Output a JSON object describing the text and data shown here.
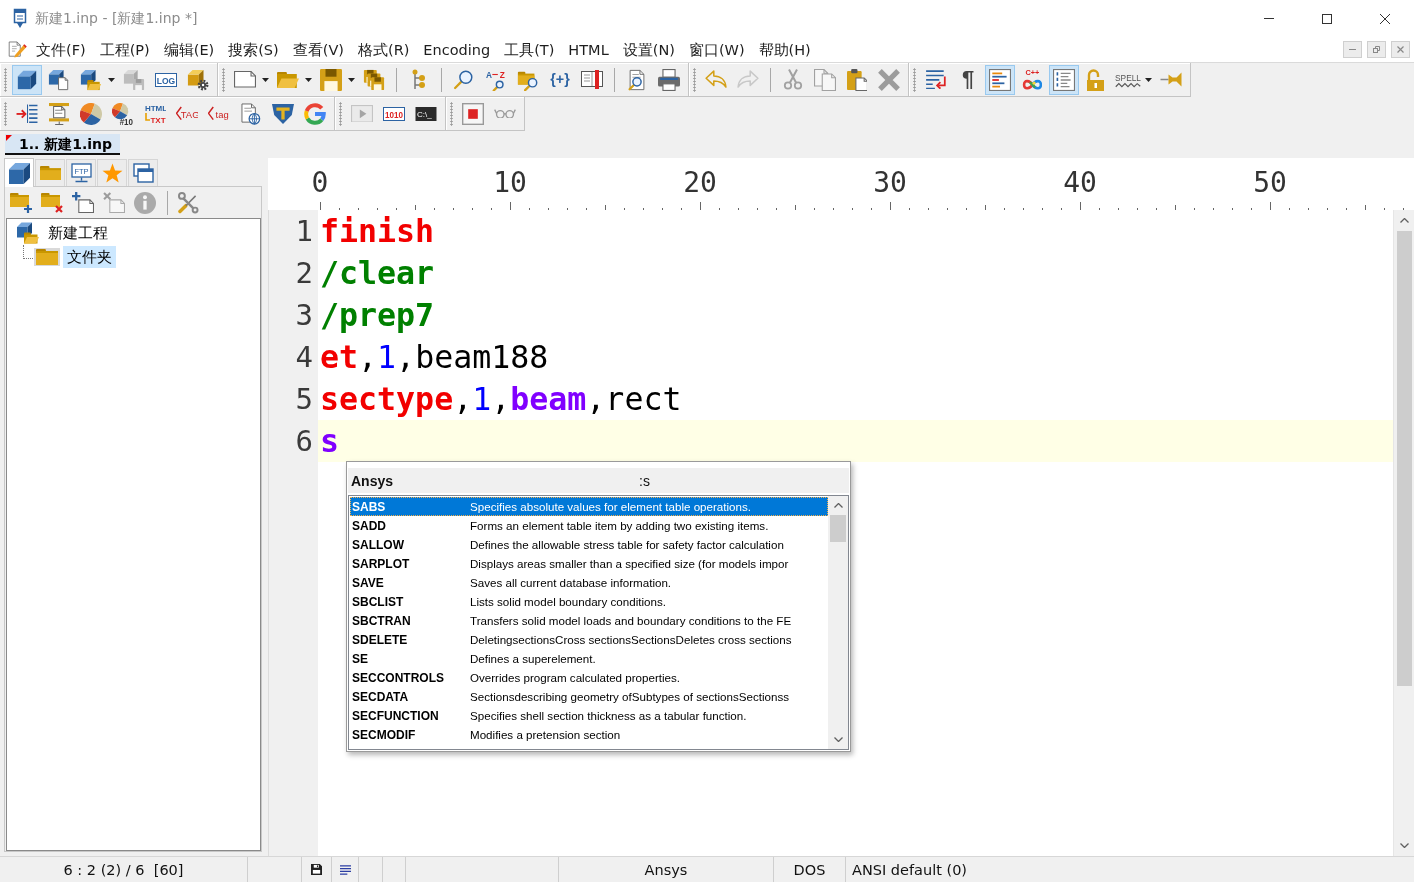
{
  "window": {
    "title": "新建1.inp - [新建1.inp *]"
  },
  "menu": [
    "文件(F)",
    "工程(P)",
    "编辑(E)",
    "搜索(S)",
    "查看(V)",
    "格式(R)",
    "Encoding",
    "工具(T)",
    "HTML",
    "设置(N)",
    "窗口(W)",
    "帮助(H)"
  ],
  "toolbar_rows": [
    {
      "bands": [
        {
          "sections": [
            [
              {
                "pressed": true,
                "disabled": false,
                "menu": false
              },
              {
                "pressed": false,
                "disabled": false,
                "menu": false
              },
              {
                "pressed": false,
                "disabled": false,
                "menu": true
              },
              {
                "pressed": false,
                "disabled": true,
                "menu": false
              },
              {
                "labels": [
                  "LOG"
                ],
                "pressed": false,
                "disabled": false,
                "menu": false
              },
              {
                "pressed": false,
                "disabled": false,
                "menu": false
              }
            ]
          ]
        },
        {
          "sections": [
            [
              {
                "pressed": false,
                "disabled": false,
                "menu": true
              },
              {
                "pressed": false,
                "disabled": false,
                "menu": true
              },
              {
                "pressed": false,
                "disabled": false,
                "menu": true
              },
              {
                "pressed": false,
                "disabled": false,
                "menu": false
              }
            ],
            [
              {
                "pressed": false,
                "disabled": false,
                "menu": false
              }
            ],
            [
              {
                "pressed": false,
                "disabled": false,
                "menu": false
              },
              {
                "labels": [
                  "A",
                  "Z"
                ],
                "pressed": false,
                "disabled": false,
                "menu": false
              },
              {
                "pressed": false,
                "disabled": false,
                "menu": false
              },
              {
                "labels": [
                  "{+}"
                ],
                "pressed": false,
                "disabled": false,
                "menu": false
              },
              {
                "pressed": false,
                "disabled": false,
                "menu": false
              }
            ],
            [
              {
                "pressed": false,
                "disabled": false,
                "menu": false
              },
              {
                "pressed": false,
                "disabled": false,
                "menu": false
              }
            ]
          ]
        },
        {
          "sections": [
            [
              {
                "pressed": false,
                "disabled": false,
                "menu": false
              },
              {
                "pressed": false,
                "disabled": true,
                "menu": false
              }
            ],
            [
              {
                "pressed": false,
                "disabled": true,
                "menu": false
              },
              {
                "pressed": false,
                "disabled": true,
                "menu": false
              },
              {
                "pressed": false,
                "disabled": false,
                "menu": false
              },
              {
                "pressed": false,
                "disabled": true,
                "menu": false
              }
            ]
          ]
        },
        {
          "sections": [
            [
              {
                "pressed": false,
                "disabled": false,
                "menu": false
              },
              {
                "labels": [
                  "¶"
                ],
                "pressed": false,
                "disabled": false,
                "menu": false
              },
              {
                "pressed": true,
                "disabled": false,
                "menu": false
              },
              {
                "labels": [
                  "C++"
                ],
                "pressed": false,
                "disabled": false,
                "menu": false
              },
              {
                "pressed": true,
                "disabled": false,
                "menu": false
              },
              {
                "pressed": false,
                "disabled": false,
                "menu": false
              },
              {
                "labels": [
                  "SPELL"
                ],
                "pressed": false,
                "disabled": false,
                "menu": true
              },
              {
                "pressed": false,
                "disabled": false,
                "menu": false
              }
            ]
          ]
        }
      ]
    },
    {
      "bands": [
        {
          "sections": [
            [
              {
                "pressed": false,
                "disabled": false,
                "menu": false
              },
              {
                "pressed": false,
                "disabled": false,
                "menu": false
              },
              {
                "pressed": false,
                "disabled": false,
                "menu": false
              },
              {
                "labels": [
                  "#10"
                ],
                "pressed": false,
                "disabled": false,
                "menu": false
              },
              {
                "labels": [
                  "HTML",
                  "TXT"
                ],
                "pressed": false,
                "disabled": false,
                "menu": false
              },
              {
                "labels": [
                  "TAG"
                ],
                "pressed": false,
                "disabled": false,
                "menu": false
              },
              {
                "labels": [
                  "tag"
                ],
                "pressed": false,
                "disabled": false,
                "menu": false
              },
              {
                "pressed": false,
                "disabled": false,
                "menu": false
              },
              {
                "pressed": false,
                "disabled": false,
                "menu": false
              },
              {
                "pressed": false,
                "disabled": false,
                "menu": false
              }
            ]
          ]
        },
        {
          "sections": [
            [
              {
                "pressed": false,
                "disabled": true,
                "menu": false
              },
              {
                "labels": [
                  "1010"
                ],
                "pressed": false,
                "disabled": false,
                "menu": false
              },
              {
                "labels": [
                  "C:\\_"
                ],
                "pressed": false,
                "disabled": false,
                "menu": false
              }
            ]
          ]
        },
        {
          "sections": [
            [
              {
                "pressed": false,
                "disabled": false,
                "menu": false
              },
              {
                "pressed": false,
                "disabled": false,
                "menu": false
              }
            ]
          ]
        }
      ]
    }
  ],
  "document_tabs": [
    {
      "label": "1.. 新建1.inp",
      "selected": true,
      "modified": true
    }
  ],
  "side_panel": {
    "tabs": [
      {
        "selected": true
      },
      {
        "selected": false
      },
      {
        "labels": [
          "FTP"
        ],
        "selected": false
      },
      {
        "selected": false
      },
      {
        "selected": false
      }
    ],
    "toolbar": [
      {
        "disabled": false
      },
      {
        "disabled": false
      },
      {
        "disabled": false
      },
      {
        "disabled": true
      },
      {
        "disabled": true
      },
      {
        "disabled": false
      }
    ],
    "tree": [
      {
        "label": "新建工程",
        "selected": false,
        "children": [
          {
            "label": "文件夹",
            "selected": true
          }
        ]
      }
    ]
  },
  "editor": {
    "ruler": [
      "0",
      "10",
      "20",
      "30",
      "40",
      "50"
    ],
    "lines": [
      {
        "number": "1",
        "current": false,
        "tokens": [
          {
            "text": "finish",
            "kind": "command"
          }
        ]
      },
      {
        "number": "2",
        "current": false,
        "tokens": [
          {
            "text": "/clear",
            "kind": "slash_command"
          }
        ]
      },
      {
        "number": "3",
        "current": false,
        "tokens": [
          {
            "text": "/prep7",
            "kind": "slash_command"
          }
        ]
      },
      {
        "number": "4",
        "current": false,
        "tokens": [
          {
            "text": "et",
            "kind": "command"
          },
          {
            "text": ",",
            "kind": "text"
          },
          {
            "text": "1",
            "kind": "number"
          },
          {
            "text": ",beam188",
            "kind": "text"
          }
        ]
      },
      {
        "number": "5",
        "current": false,
        "tokens": [
          {
            "text": "sectype",
            "kind": "command"
          },
          {
            "text": ",",
            "kind": "text"
          },
          {
            "text": "1",
            "kind": "number"
          },
          {
            "text": ",",
            "kind": "text"
          },
          {
            "text": "beam",
            "kind": "keyword"
          },
          {
            "text": ",rect",
            "kind": "text"
          }
        ]
      },
      {
        "number": "6",
        "current": true,
        "tokens": [
          {
            "text": "s",
            "kind": "keyword"
          }
        ]
      }
    ]
  },
  "autocomplete": {
    "title": "Ansys",
    "filter": ":s",
    "items": [
      {
        "name": "SABS",
        "description": "Specifies absolute values for element table operations.",
        "selected": true
      },
      {
        "name": "SADD",
        "description": "Forms an element table item by adding two existing items.",
        "selected": false
      },
      {
        "name": "SALLOW",
        "description": "Defines the allowable stress table for safety factor calculation",
        "selected": false
      },
      {
        "name": "SARPLOT",
        "description": "Displays areas smaller than a specified size (for models impor",
        "selected": false
      },
      {
        "name": "SAVE",
        "description": "Saves all current database information.",
        "selected": false
      },
      {
        "name": "SBCLIST",
        "description": "Lists solid model boundary conditions.",
        "selected": false
      },
      {
        "name": "SBCTRAN",
        "description": "Transfers solid model loads and boundary conditions to the FE",
        "selected": false
      },
      {
        "name": "SDELETE",
        "description": "DeletingsectionsCross sectionsSectionsDeletes cross sections",
        "selected": false
      },
      {
        "name": "SE",
        "description": "Defines a superelement.",
        "selected": false
      },
      {
        "name": "SECCONTROLS",
        "description": "Overrides program calculated properties.",
        "selected": false
      },
      {
        "name": "SECDATA",
        "description": "Sectionsdescribing geometry ofSubtypes of sectionsSectionss",
        "selected": false
      },
      {
        "name": "SECFUNCTION",
        "description": "Specifies shell section thickness as a tabular function.",
        "selected": false
      },
      {
        "name": "SECMODIF",
        "description": "Modifies a pretension section",
        "selected": false
      }
    ]
  },
  "status_bar": {
    "position": "6 : 2 (2) / 6  [60]",
    "language": "Ansys",
    "line_endings": "DOS",
    "encoding": "ANSI default (0)"
  }
}
